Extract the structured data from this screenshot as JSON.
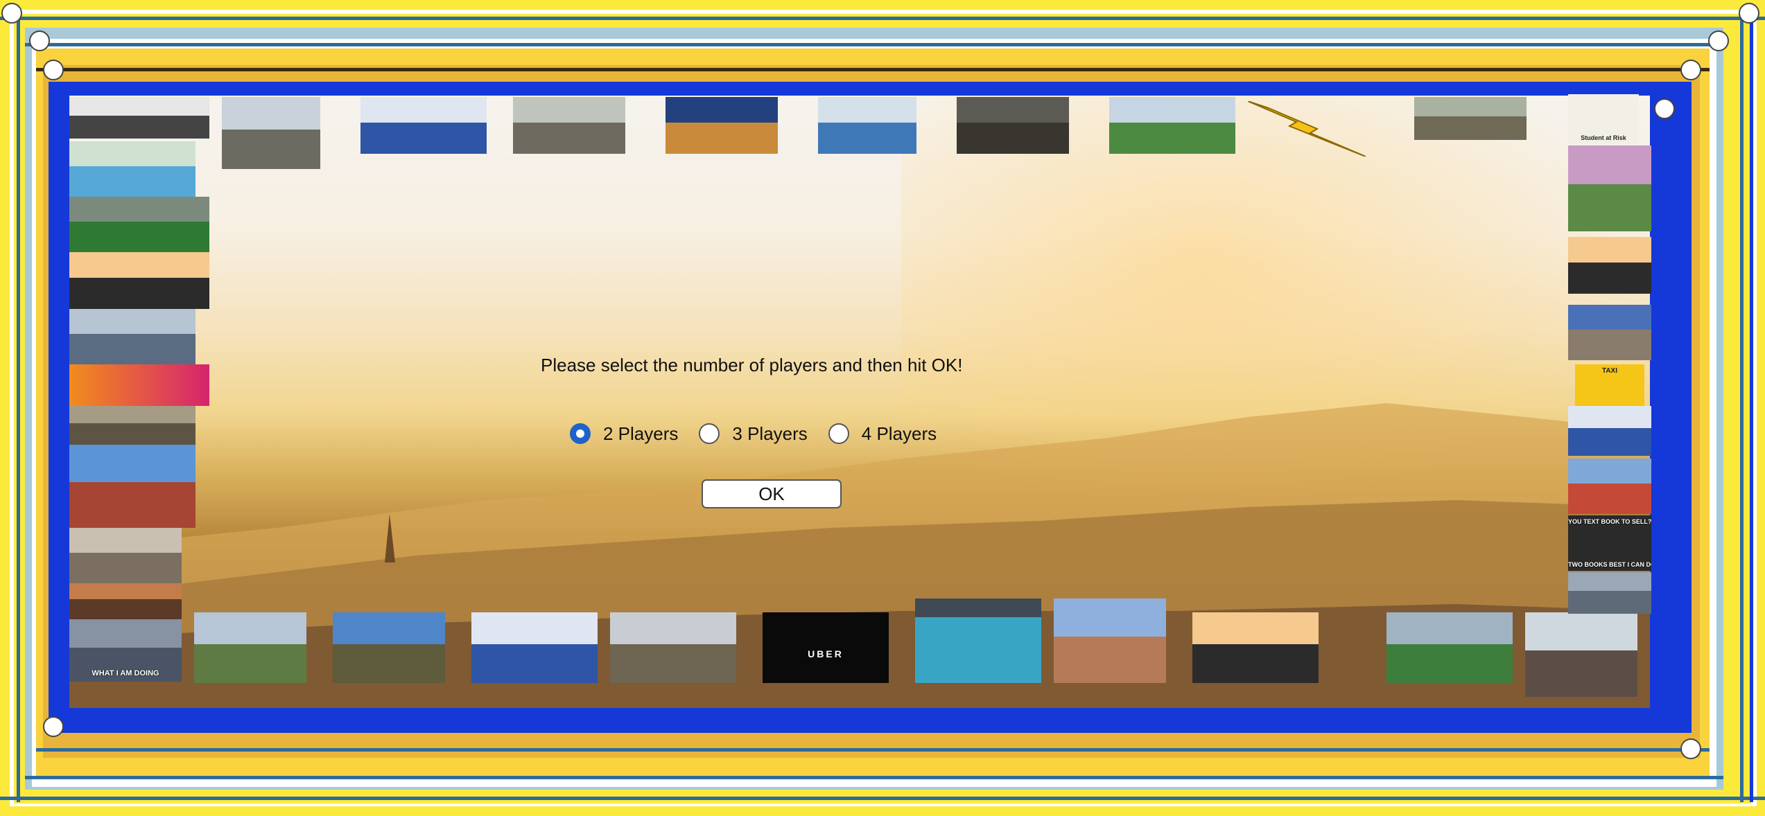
{
  "dialog": {
    "prompt": "Please select the number of players and then hit OK!",
    "options": [
      {
        "label": "2 Players",
        "selected": true
      },
      {
        "label": "3 Players",
        "selected": false
      },
      {
        "label": "4 Players",
        "selected": false
      }
    ],
    "ok_label": "OK"
  },
  "tiles": {
    "student_at_risk": "Student at Risk",
    "what_i_am_doing": "WHAT I AM DOING",
    "uber": "UBER",
    "textbook_sell": "YOU TEXT BOOK TO SELL?",
    "textbook_best": "TWO BOOKS BEST I CAN DO",
    "taxi": "TAXI"
  },
  "colors": {
    "selected_radio": "#1e63c9",
    "frame_yellow": "#fbe93c",
    "frame_blue": "#1538d8",
    "frame_lightblue": "#a8c9d8"
  }
}
